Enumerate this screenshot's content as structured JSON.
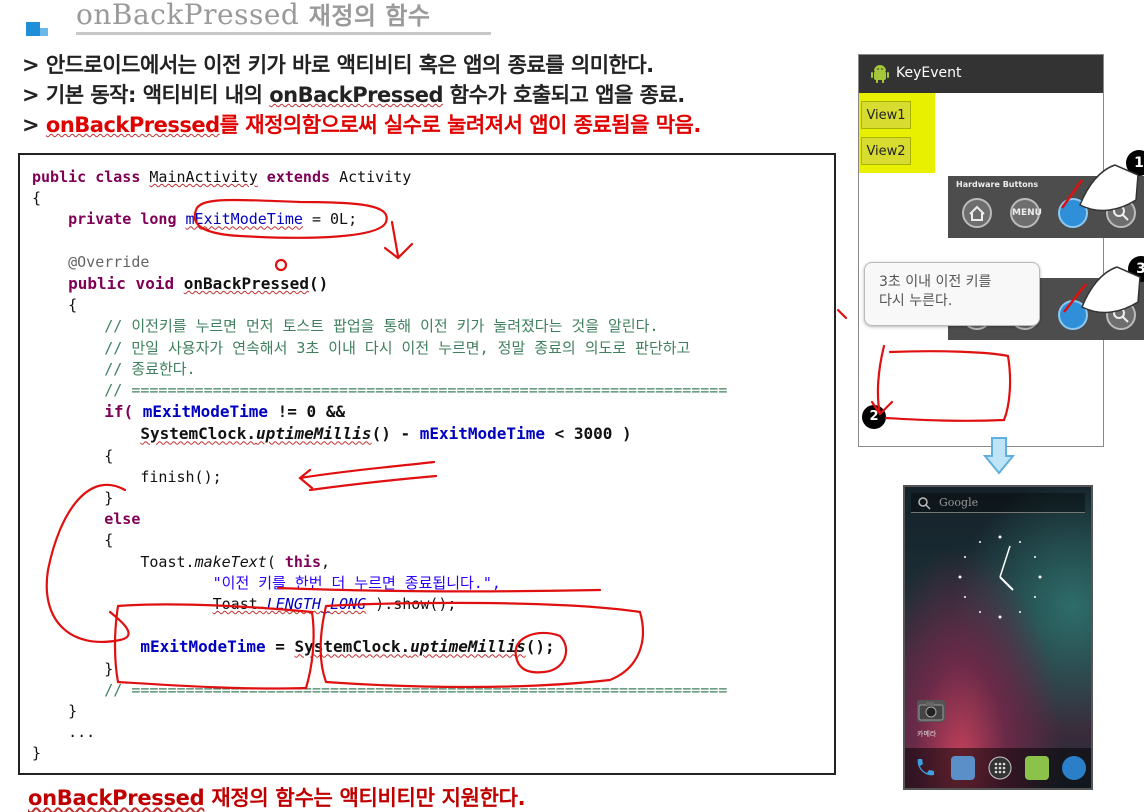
{
  "header": {
    "title_code": "onBackPressed",
    "title_rest": "재정의 함수"
  },
  "bullets": [
    "> 안드로이드에서는 이전 키가 바로 액티비티 혹은 앱의 종료를 의미한다.",
    {
      "pre": "> 기본 동작: 액티비티 내의 ",
      "code": "onBackPressed",
      "post": " 함수가 호출되고 앱을 종료."
    },
    {
      "pre": "> ",
      "code": "onBackPressed",
      "post": "를 재정의함으로써 실수로 눌려져서 앱이 종료됨을 막음."
    }
  ],
  "code": {
    "l1": [
      "public class ",
      "MainActivity",
      " extends ",
      "Activity"
    ],
    "l2": "{",
    "l3": [
      "private long ",
      "mExitModeTime",
      " = 0L;"
    ],
    "l5": "@Override",
    "l6": [
      "public void ",
      "onBackPressed",
      "()"
    ],
    "l7": "{",
    "c1": "// 이전키를 누르면 먼저 토스트 팝업을 통해 이전 키가 눌려졌다는 것을 알린다.",
    "c2": "// 만일 사용자가 연속해서 3초 이내 다시 이전 누르면, 정말 종료의 의도로 판단하고",
    "c3": "// 종료한다.",
    "c4": "// ==================================================================",
    "if1": [
      "if( ",
      "mExitModeTime",
      " != 0 &&"
    ],
    "if2": [
      "SystemClock.",
      "uptimeMillis",
      "() - ",
      "mExitModeTime",
      " < 3000 )"
    ],
    "b1": "{",
    "finish": "finish();",
    "b2": "}",
    "else": "else",
    "b3": "{",
    "t1": [
      "Toast.",
      "makeText",
      "( ",
      "this",
      ","
    ],
    "t2": "\"이전 키를 한번 더 누르면 종료됩니다.\",",
    "t3": [
      "Toast.",
      "LENGTH_LONG",
      " ).show();"
    ],
    "assign": [
      "mExitModeTime",
      " = ",
      "SystemClock.",
      "uptimeMillis",
      "();"
    ],
    "b4": "}",
    "c5": "// ==================================================================",
    "b5": "}",
    "dots": "...",
    "b6": "}"
  },
  "footer": {
    "code": "onBackPressed",
    "rest": " 재정의 함수는 액티비티만 지원한다."
  },
  "emulator": {
    "app_title": "KeyEvent",
    "view1": "View1",
    "view2": "View2",
    "hw_title": "Hardware Buttons",
    "menu_label": "MENU",
    "badge1": "1",
    "badge2": "2",
    "badge3": "3",
    "toast": "3초 이내 이전 키를\n다시 누른다.",
    "search_placeholder": "Google",
    "camera_label": "카메라"
  },
  "colors": {
    "keyword": "#7f0055",
    "field": "#0000c0",
    "comment": "#3f7f5f",
    "string": "#2a00ff",
    "accent_red": "#e00000",
    "ink_red": "#e01010"
  }
}
